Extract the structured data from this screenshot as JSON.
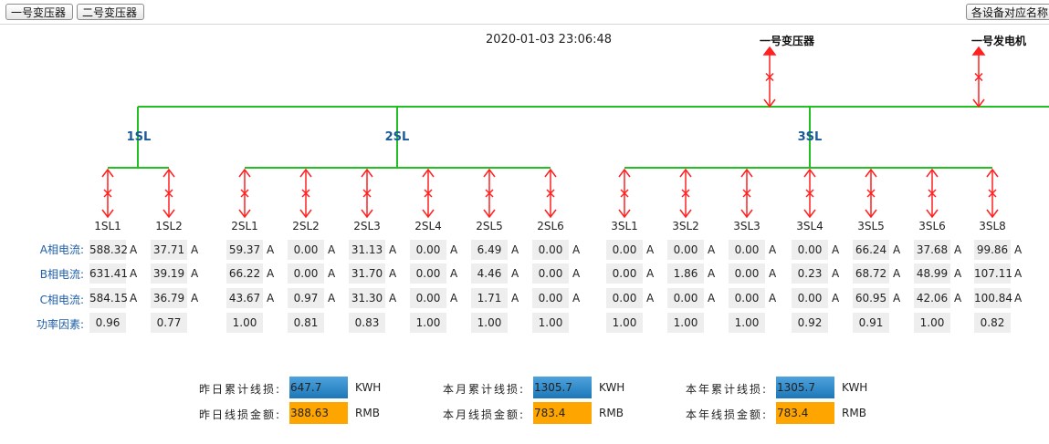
{
  "toolbar": {
    "tab1": "一号变压器",
    "tab2": "二号变压器",
    "right_button": "各设备对应名称"
  },
  "timestamp": "2020-01-03 23:06:48",
  "sources": [
    {
      "name": "一号变压器"
    },
    {
      "name": "一号发电机"
    }
  ],
  "buses": [
    "1SL",
    "2SL",
    "3SL"
  ],
  "colors": {
    "bus_line": "#22c022",
    "switch": "#ff2020",
    "label_blue": "#1f5fa8"
  },
  "row_labels": {
    "a": "A相电流:",
    "b": "B相电流:",
    "c": "C相电流:",
    "pf": "功率因素:"
  },
  "current_unit": "A",
  "feeders": [
    {
      "name": "1SL1",
      "a": "588.32",
      "b": "631.41",
      "c": "584.15",
      "pf": "0.96"
    },
    {
      "name": "1SL2",
      "a": "37.71",
      "b": "39.19",
      "c": "36.79",
      "pf": "0.77"
    },
    {
      "name": "2SL1",
      "a": "59.37",
      "b": "66.22",
      "c": "43.67",
      "pf": "1.00"
    },
    {
      "name": "2SL2",
      "a": "0.00",
      "b": "0.00",
      "c": "0.97",
      "pf": "0.81"
    },
    {
      "name": "2SL3",
      "a": "31.13",
      "b": "31.70",
      "c": "31.30",
      "pf": "0.83"
    },
    {
      "name": "2SL4",
      "a": "0.00",
      "b": "0.00",
      "c": "0.00",
      "pf": "1.00"
    },
    {
      "name": "2SL5",
      "a": "6.49",
      "b": "4.46",
      "c": "1.71",
      "pf": "1.00"
    },
    {
      "name": "2SL6",
      "a": "0.00",
      "b": "0.00",
      "c": "0.00",
      "pf": "1.00"
    },
    {
      "name": "3SL1",
      "a": "0.00",
      "b": "0.00",
      "c": "0.00",
      "pf": "1.00"
    },
    {
      "name": "3SL2",
      "a": "0.00",
      "b": "1.86",
      "c": "0.00",
      "pf": "1.00"
    },
    {
      "name": "3SL3",
      "a": "0.00",
      "b": "0.00",
      "c": "0.00",
      "pf": "1.00"
    },
    {
      "name": "3SL4",
      "a": "0.00",
      "b": "0.23",
      "c": "0.00",
      "pf": "0.92"
    },
    {
      "name": "3SL5",
      "a": "66.24",
      "b": "68.72",
      "c": "60.95",
      "pf": "0.91"
    },
    {
      "name": "3SL6",
      "a": "37.68",
      "b": "48.99",
      "c": "42.06",
      "pf": "1.00"
    },
    {
      "name": "3SL8",
      "a": "99.86",
      "b": "107.11",
      "c": "100.84",
      "pf": "0.82"
    }
  ],
  "summary": {
    "yesterday_loss_label": "昨日累计线损:",
    "yesterday_loss_value": "647.7",
    "yesterday_loss_unit": "KWH",
    "yesterday_cost_label": "昨日线损金额:",
    "yesterday_cost_value": "388.63",
    "yesterday_cost_unit": "RMB",
    "month_loss_label": "本月累计线损:",
    "month_loss_value": "1305.7",
    "month_loss_unit": "KWH",
    "month_cost_label": "本月线损金额:",
    "month_cost_value": "783.4",
    "month_cost_unit": "RMB",
    "year_loss_label": "本年累计线损:",
    "year_loss_value": "1305.7",
    "year_loss_unit": "KWH",
    "year_cost_label": "本年线损金额:",
    "year_cost_value": "783.4",
    "year_cost_unit": "RMB"
  }
}
